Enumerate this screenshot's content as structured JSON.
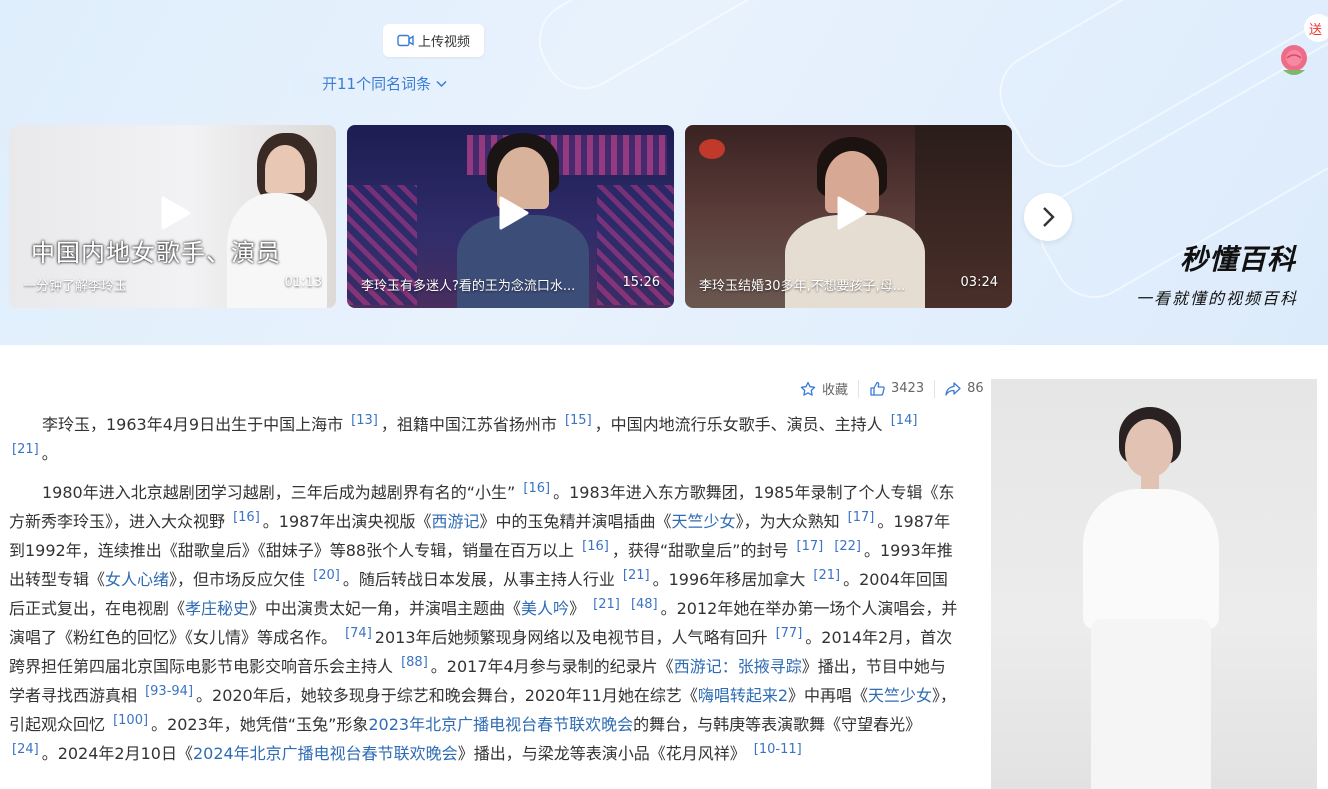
{
  "header": {
    "upload_label": "上传视频",
    "homonym_label": "开11个同名词条",
    "gift_label": "送"
  },
  "videos": [
    {
      "overlay": "中国内地女歌手、演员",
      "title": "一分钟了解李玲玉",
      "duration": "01:13"
    },
    {
      "title": "李玲玉有多迷人?看的王为念流口水...",
      "duration": "15:26"
    },
    {
      "title": "李玲玉结婚30多年,不想要孩子,母...",
      "duration": "03:24"
    }
  ],
  "brand": {
    "name": "秒懂百科",
    "slogan": "一看就懂的视频百科"
  },
  "actions": {
    "collect": "收藏",
    "likes": "3423",
    "shares": "86"
  },
  "article": {
    "p1": [
      {
        "t": "李玲玉，1963年4月9日出生于中国上海市 "
      },
      {
        "s": "[13]"
      },
      {
        "t": "，祖籍中国江苏省扬州市 "
      },
      {
        "s": "[15]"
      },
      {
        "t": "，中国内地流行乐女歌手、演员、主持人 "
      },
      {
        "s": "[14]"
      },
      {
        "t": " "
      },
      {
        "s": "[21]"
      },
      {
        "t": "。"
      }
    ],
    "p2": [
      {
        "t": "1980年进入北京越剧团学习越剧，三年后成为越剧界有名的“小生” "
      },
      {
        "s": "[16]"
      },
      {
        "t": "。1983年进入东方歌舞团，1985年录制了个人专辑《东方新秀李玲玉》，进入大众视野 "
      },
      {
        "s": "[16]"
      },
      {
        "t": "。1987年出演央视版《"
      },
      {
        "l": "西游记"
      },
      {
        "t": "》中的玉兔精并演唱插曲《"
      },
      {
        "l": "天竺少女"
      },
      {
        "t": "》，为大众熟知 "
      },
      {
        "s": "[17]"
      },
      {
        "t": "。1987年到1992年，连续推出《甜歌皇后》《甜妹子》等88张个人专辑，销量在百万以上 "
      },
      {
        "s": "[16]"
      },
      {
        "t": "，获得“甜歌皇后”的封号 "
      },
      {
        "s": "[17]"
      },
      {
        "t": " "
      },
      {
        "s": "[22]"
      },
      {
        "t": "。1993年推出转型专辑《"
      },
      {
        "l": "女人心绪"
      },
      {
        "t": "》，但市场反应欠佳 "
      },
      {
        "s": "[20]"
      },
      {
        "t": "。随后转战日本发展，从事主持人行业 "
      },
      {
        "s": "[21]"
      },
      {
        "t": "。1996年移居加拿大 "
      },
      {
        "s": "[21]"
      },
      {
        "t": "。2004年回国后正式复出，在电视剧《"
      },
      {
        "l": "孝庄秘史"
      },
      {
        "t": "》中出演贵太妃一角，并演唱主题曲《"
      },
      {
        "l": "美人吟"
      },
      {
        "t": "》 "
      },
      {
        "s": "[21]"
      },
      {
        "t": " "
      },
      {
        "s": "[48]"
      },
      {
        "t": "。2012年她在举办第一场个人演唱会，并演唱了《粉红色的回忆》《女儿情》等成名作。 "
      },
      {
        "s": "[74]"
      },
      {
        "t": "2013年后她频繁现身网络以及电视节目，人气略有回升 "
      },
      {
        "s": "[77]"
      },
      {
        "t": "。2014年2月，首次跨界担任第四届北京国际电影节电影交响音乐会主持人 "
      },
      {
        "s": "[88]"
      },
      {
        "t": "。2017年4月参与录制的纪录片《"
      },
      {
        "l": "西游记：张掖寻踪"
      },
      {
        "t": "》播出，节目中她与学者寻找西游真相 "
      },
      {
        "s": "[93-94]"
      },
      {
        "t": "。2020年后，她较多现身于综艺和晚会舞台，2020年11月她在综艺《"
      },
      {
        "l": "嗨唱转起来2"
      },
      {
        "t": "》中再唱《"
      },
      {
        "l": "天竺少女"
      },
      {
        "t": "》，引起观众回忆 "
      },
      {
        "s": "[100]"
      },
      {
        "t": "。2023年，她凭借“玉兔”形象"
      },
      {
        "l": "2023年北京广播电视台春节联欢晚会"
      },
      {
        "t": "的舞台，与韩庚等表演歌舞《守望春光》 "
      },
      {
        "s": "[24]"
      },
      {
        "t": "。2024年2月10日《"
      },
      {
        "l": "2024年北京广播电视台春节联欢晚会"
      },
      {
        "t": "》播出，与梁龙等表演小品《花月风祥》 "
      },
      {
        "s": "[10-11]"
      }
    ]
  }
}
